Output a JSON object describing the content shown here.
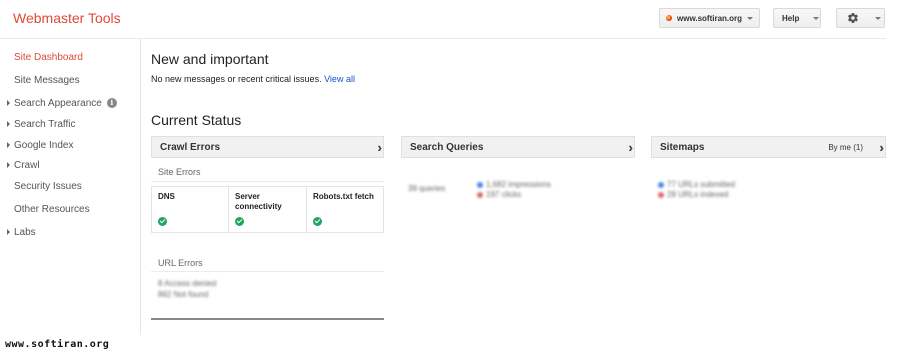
{
  "header": {
    "app_title": "Webmaster Tools",
    "site_selector": "www.softiran.org",
    "help_label": "Help"
  },
  "sidebar": {
    "items": [
      {
        "label": "Site Dashboard",
        "active": true,
        "expandable": false
      },
      {
        "label": "Site Messages",
        "active": false,
        "expandable": false
      },
      {
        "label": "Search Appearance",
        "active": false,
        "expandable": true,
        "info": true
      },
      {
        "label": "Search Traffic",
        "active": false,
        "expandable": true
      },
      {
        "label": "Google Index",
        "active": false,
        "expandable": true
      },
      {
        "label": "Crawl",
        "active": false,
        "expandable": true
      },
      {
        "label": "Security Issues",
        "active": false,
        "expandable": false
      },
      {
        "label": "Other Resources",
        "active": false,
        "expandable": false
      },
      {
        "label": "Labs",
        "active": false,
        "expandable": true
      }
    ],
    "info_icon": "i"
  },
  "main": {
    "new_important_title": "New and important",
    "notice_text": "No new messages or recent critical issues.",
    "view_all_label": "View all",
    "current_status_title": "Current Status",
    "panels": {
      "crawl_errors": {
        "title": "Crawl Errors",
        "site_errors_label": "Site Errors",
        "cells": [
          {
            "label": "DNS"
          },
          {
            "label": "Server connectivity"
          },
          {
            "label": "Robots.txt fetch"
          }
        ],
        "url_errors_label": "URL Errors",
        "url_lines": [
          "8 Access denied",
          "862 Not found"
        ]
      },
      "search_queries": {
        "title": "Search Queries",
        "queries_text": "39 queries",
        "lines": [
          "1,682 impressions",
          "197 clicks"
        ]
      },
      "sitemaps": {
        "title": "Sitemaps",
        "by_me": "By me (1)",
        "lines": [
          "77 URLs submitted",
          "28 URLs indexed"
        ]
      }
    }
  },
  "watermark": "www.softiran.org",
  "colors": {
    "accent_red": "#dd4b39",
    "link_blue": "#1155cc",
    "ok_green": "#1fa65a",
    "series_blue": "#4a86e8",
    "series_red": "#e06666"
  }
}
